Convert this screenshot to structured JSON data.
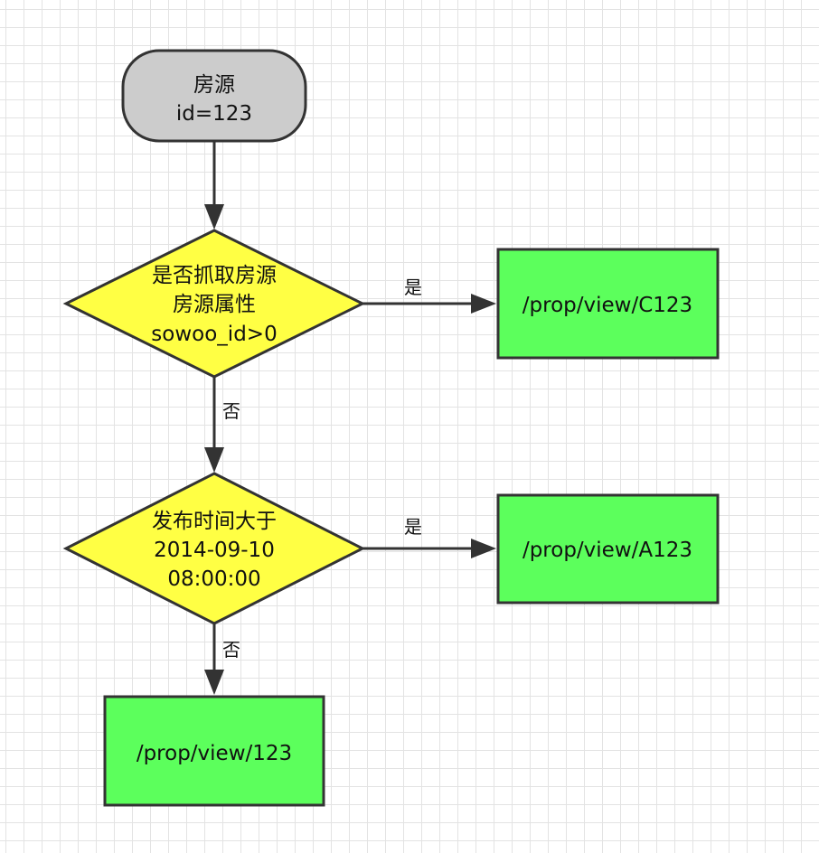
{
  "diagram": {
    "start": {
      "line1": "房源",
      "line2": "id=123",
      "fill": "#cccccc"
    },
    "decision1": {
      "line1": "是否抓取房源",
      "line2": "房源属性",
      "line3": "sowoo_id>0",
      "fill": "#ffff44"
    },
    "decision2": {
      "line1": "发布时间大于",
      "line2": "2014-09-10",
      "line3": "08:00:00",
      "fill": "#ffff44"
    },
    "result_c": {
      "label": "/prop/view/C123",
      "fill": "#5cff5c"
    },
    "result_a": {
      "label": "/prop/view/A123",
      "fill": "#5cff5c"
    },
    "result_default": {
      "label": "/prop/view/123",
      "fill": "#5cff5c"
    },
    "edges": {
      "yes1": "是",
      "no1": "否",
      "yes2": "是",
      "no2": "否"
    }
  }
}
